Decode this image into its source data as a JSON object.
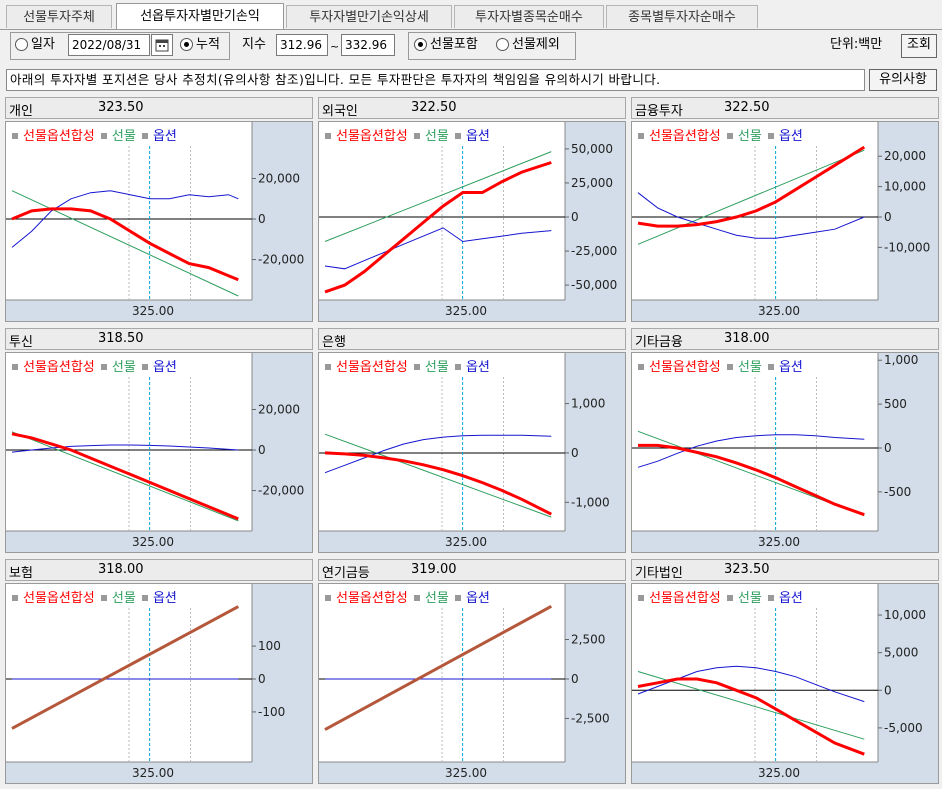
{
  "tabs": [
    {
      "label": "선물투자주체",
      "active": false
    },
    {
      "label": "선옵투자자별만기손익",
      "active": true
    },
    {
      "label": "투자자별만기손익상세",
      "active": false
    },
    {
      "label": "투자자별종목순매수",
      "active": false
    },
    {
      "label": "종목별투자자순매수",
      "active": false
    }
  ],
  "controls": {
    "daily_label": "일자",
    "date_value": "2022/08/31",
    "cumulative_label": "누적",
    "index_label": "지수",
    "index_from": "312.96",
    "index_to": "332.96",
    "tilde": "~",
    "include_futures_label": "선물포함",
    "exclude_futures_label": "선물제외",
    "unit_label": "단위:백만",
    "query_button": "조회"
  },
  "notice": {
    "text": "아래의 투자자별 포지션은 당사 추정치(유의사항 참조)입니다. 모든 투자판단은 투자자의 책임임을 유의하시기 바랍니다.",
    "button": "유의사항"
  },
  "legend": {
    "combined": "선물옵션합성",
    "futures": "선물",
    "options": "옵션"
  },
  "colors": {
    "combined": "#ff0000",
    "futures": "#2e9e5e",
    "options": "#1515d0",
    "cursor": "#00a8d8",
    "axis_bg": "#d2dde9"
  },
  "panels": [
    {
      "id": "individual",
      "name": "개인",
      "value": "323.50",
      "x_label": "325.00",
      "y_ticks": [
        "20,000",
        "0",
        "-20,000"
      ],
      "chart_data": {
        "type": "line",
        "ylim": [
          -38000,
          40000
        ],
        "xlim": [
          310,
          335
        ],
        "cursor_x": 325,
        "series": [
          {
            "key": "combined",
            "x": [
              310,
              312,
              314,
              316,
              318,
              319,
              320,
              322,
              324,
              326,
              328,
              330,
              332,
              333
            ],
            "y": [
              0,
              4000,
              5000,
              5000,
              4000,
              2000,
              0,
              -6000,
              -12000,
              -17000,
              -22000,
              -24000,
              -28000,
              -30000
            ]
          },
          {
            "key": "futures",
            "x": [
              310,
              333
            ],
            "y": [
              14000,
              -38000
            ]
          },
          {
            "key": "options",
            "x": [
              310,
              312,
              314,
              316,
              318,
              320,
              322,
              324,
              326,
              328,
              330,
              332,
              333
            ],
            "y": [
              -14000,
              -6000,
              4000,
              10000,
              13000,
              14000,
              12000,
              10000,
              10000,
              12000,
              11000,
              12000,
              10000
            ]
          }
        ]
      }
    },
    {
      "id": "foreigner",
      "name": "외국인",
      "value": "322.50",
      "x_label": "325.00",
      "y_ticks": [
        "50,000",
        "25,000",
        "0",
        "-25,000",
        "-50,000"
      ],
      "chart_data": {
        "type": "line",
        "ylim": [
          -58000,
          58000
        ],
        "xlim": [
          310,
          335
        ],
        "cursor_x": 325,
        "series": [
          {
            "key": "combined",
            "x": [
              310,
              312,
              314,
              316,
              318,
              320,
              322,
              324,
              326,
              328,
              330,
              333
            ],
            "y": [
              -55000,
              -50000,
              -40000,
              -28000,
              -16000,
              -4000,
              8000,
              18000,
              18000,
              26000,
              33000,
              40000
            ]
          },
          {
            "key": "futures",
            "x": [
              310,
              333
            ],
            "y": [
              -18000,
              48000
            ]
          },
          {
            "key": "options",
            "x": [
              310,
              312,
              314,
              316,
              318,
              320,
              322,
              324,
              326,
              328,
              330,
              333
            ],
            "y": [
              -36000,
              -38000,
              -32000,
              -26000,
              -20000,
              -14000,
              -8000,
              -18000,
              -16000,
              -14000,
              -12000,
              -10000
            ]
          }
        ]
      }
    },
    {
      "id": "financial_investment",
      "name": "금융투자",
      "value": "322.50",
      "x_label": "325.00",
      "y_ticks": [
        "20,000",
        "10,000",
        "0",
        "-10,000"
      ],
      "chart_data": {
        "type": "line",
        "ylim": [
          -26000,
          26000
        ],
        "xlim": [
          310,
          335
        ],
        "cursor_x": 325,
        "series": [
          {
            "key": "combined",
            "x": [
              310,
              312,
              314,
              316,
              318,
              320,
              322,
              324,
              326,
              328,
              330,
              333
            ],
            "y": [
              -2000,
              -3000,
              -3000,
              -2500,
              -1500,
              0,
              2000,
              5000,
              9000,
              13000,
              17000,
              23000
            ]
          },
          {
            "key": "futures",
            "x": [
              310,
              333
            ],
            "y": [
              -9000,
              22000
            ]
          },
          {
            "key": "options",
            "x": [
              310,
              312,
              314,
              316,
              318,
              320,
              322,
              324,
              326,
              328,
              330,
              333
            ],
            "y": [
              8000,
              3000,
              0,
              -2000,
              -4000,
              -6000,
              -7000,
              -7000,
              -6000,
              -5000,
              -4000,
              0
            ]
          }
        ]
      }
    },
    {
      "id": "investment_trust",
      "name": "투신",
      "value": "318.50",
      "x_label": "325.00",
      "y_ticks": [
        "20,000",
        "0",
        "-20,000"
      ],
      "chart_data": {
        "type": "line",
        "ylim": [
          -38000,
          40000
        ],
        "xlim": [
          310,
          335
        ],
        "cursor_x": 325,
        "series": [
          {
            "key": "combined",
            "x": [
              310,
              312,
              314,
              316,
              318,
              320,
              322,
              324,
              326,
              328,
              330,
              333
            ],
            "y": [
              8000,
              6000,
              3000,
              0,
              -4000,
              -8000,
              -12000,
              -16000,
              -20000,
              -24000,
              -28000,
              -34000
            ]
          },
          {
            "key": "futures",
            "x": [
              310,
              333
            ],
            "y": [
              9000,
              -35000
            ]
          },
          {
            "key": "options",
            "x": [
              310,
              312,
              314,
              316,
              318,
              320,
              322,
              324,
              326,
              328,
              330,
              333
            ],
            "y": [
              -1000,
              0,
              1000,
              1800,
              2200,
              2500,
              2500,
              2300,
              2000,
              1500,
              1000,
              0
            ]
          }
        ]
      }
    },
    {
      "id": "bank",
      "name": "은행",
      "value": "",
      "x_label": "325.00",
      "y_ticks": [
        "1,000",
        "0",
        "-1,000"
      ],
      "chart_data": {
        "type": "line",
        "ylim": [
          -1500,
          1700
        ],
        "xlim": [
          310,
          335
        ],
        "cursor_x": 325,
        "series": [
          {
            "key": "combined",
            "x": [
              310,
              312,
              314,
              316,
              318,
              320,
              322,
              324,
              326,
              328,
              330,
              333
            ],
            "y": [
              0,
              -20,
              -50,
              -100,
              -160,
              -240,
              -340,
              -460,
              -600,
              -760,
              -940,
              -1240
            ]
          },
          {
            "key": "futures",
            "x": [
              310,
              333
            ],
            "y": [
              380,
              -1300
            ]
          },
          {
            "key": "options",
            "x": [
              310,
              312,
              314,
              316,
              318,
              320,
              322,
              324,
              326,
              328,
              330,
              333
            ],
            "y": [
              -400,
              -250,
              -100,
              50,
              180,
              270,
              320,
              350,
              360,
              360,
              360,
              340
            ]
          }
        ]
      }
    },
    {
      "id": "other_finance",
      "name": "기타금융",
      "value": "318.00",
      "x_label": "325.00",
      "y_ticks": [
        "1,000",
        "500",
        "0",
        "-500"
      ],
      "chart_data": {
        "type": "line",
        "ylim": [
          -900,
          900
        ],
        "xlim": [
          310,
          335
        ],
        "cursor_x": 325,
        "series": [
          {
            "key": "combined",
            "x": [
              310,
              312,
              314,
              316,
              318,
              320,
              322,
              324,
              326,
              328,
              330,
              333
            ],
            "y": [
              30,
              30,
              0,
              -50,
              -100,
              -170,
              -250,
              -340,
              -440,
              -540,
              -640,
              -760
            ]
          },
          {
            "key": "futures",
            "x": [
              310,
              333
            ],
            "y": [
              190,
              -770
            ]
          },
          {
            "key": "options",
            "x": [
              310,
              312,
              314,
              316,
              318,
              320,
              322,
              324,
              326,
              328,
              330,
              333
            ],
            "y": [
              -220,
              -150,
              -60,
              20,
              80,
              120,
              140,
              150,
              150,
              140,
              120,
              100
            ]
          }
        ]
      }
    },
    {
      "id": "insurance",
      "name": "보험",
      "value": "318.00",
      "x_label": "325.00",
      "y_ticks": [
        "100",
        "0",
        "-100"
      ],
      "chart_data": {
        "type": "line",
        "ylim": [
          -240,
          240
        ],
        "xlim": [
          310,
          335
        ],
        "cursor_x": 325,
        "series": [
          {
            "key": "combined",
            "x": [
              310,
              333
            ],
            "y": [
              -150,
              220
            ]
          },
          {
            "key": "futures",
            "x": [
              310,
              333
            ],
            "y": [
              -150,
              220
            ]
          },
          {
            "key": "options",
            "x": [
              310,
              333
            ],
            "y": [
              0,
              0
            ]
          }
        ]
      }
    },
    {
      "id": "pension",
      "name": "연기금등",
      "value": "319.00",
      "x_label": "325.00",
      "y_ticks": [
        "2,500",
        "0",
        "-2,500"
      ],
      "chart_data": {
        "type": "line",
        "ylim": [
          -5000,
          5000
        ],
        "xlim": [
          310,
          335
        ],
        "cursor_x": 325,
        "series": [
          {
            "key": "combined",
            "x": [
              310,
              333
            ],
            "y": [
              -3200,
              4600
            ]
          },
          {
            "key": "futures",
            "x": [
              310,
              333
            ],
            "y": [
              -3200,
              4600
            ]
          },
          {
            "key": "options",
            "x": [
              310,
              333
            ],
            "y": [
              0,
              0
            ]
          }
        ]
      }
    },
    {
      "id": "other_corp",
      "name": "기타법인",
      "value": "323.50",
      "x_label": "325.00",
      "y_ticks": [
        "10,000",
        "5,000",
        "0",
        "-5,000"
      ],
      "chart_data": {
        "type": "line",
        "ylim": [
          -9000,
          12000
        ],
        "xlim": [
          310,
          335
        ],
        "cursor_x": 325,
        "series": [
          {
            "key": "combined",
            "x": [
              310,
              312,
              314,
              316,
              318,
              320,
              322,
              324,
              326,
              328,
              330,
              333
            ],
            "y": [
              500,
              1000,
              1500,
              1500,
              1000,
              0,
              -1000,
              -2500,
              -4000,
              -5500,
              -7000,
              -8500
            ]
          },
          {
            "key": "futures",
            "x": [
              310,
              333
            ],
            "y": [
              2500,
              -6500
            ]
          },
          {
            "key": "options",
            "x": [
              310,
              312,
              314,
              316,
              318,
              320,
              322,
              324,
              326,
              328,
              330,
              333
            ],
            "y": [
              -500,
              500,
              1500,
              2500,
              3000,
              3200,
              3000,
              2500,
              1800,
              800,
              -200,
              -1500
            ]
          }
        ]
      }
    }
  ]
}
